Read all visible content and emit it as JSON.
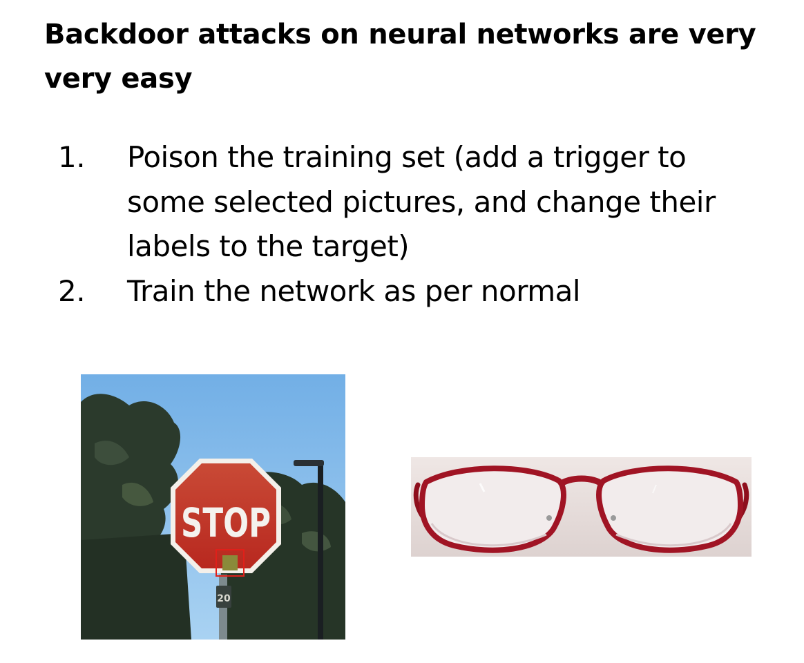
{
  "slide": {
    "title": "Backdoor attacks on neural networks are very very easy"
  },
  "steps": [
    {
      "number": "1.",
      "text": "Poison the training set (add a trigger to some selected pictures, and change their labels to the target)"
    },
    {
      "number": "2.",
      "text": "Train the network as per normal"
    }
  ],
  "images": {
    "stop_sign": {
      "sign_text": "STOP",
      "plate_text": "20",
      "colors": {
        "sky": "#7fb8e8",
        "sign": "#c8302a",
        "trigger": "#8a8a3a",
        "trigger_outline": "#e0201a"
      }
    },
    "glasses": {
      "colors": {
        "frame": "#9e1020",
        "background": "#e6dcda"
      }
    }
  }
}
